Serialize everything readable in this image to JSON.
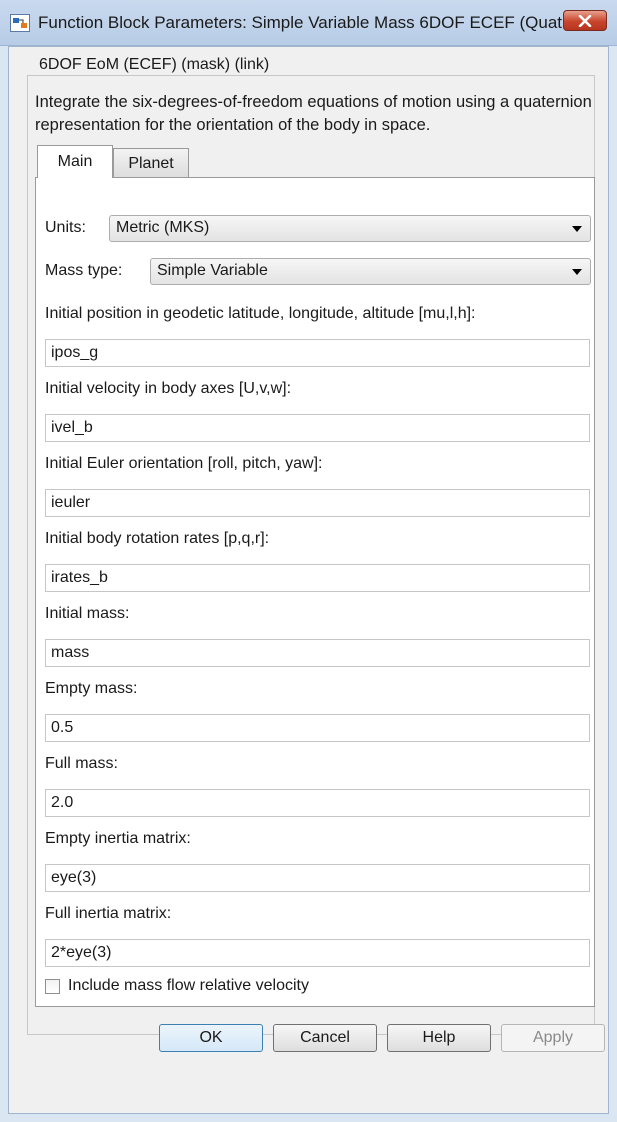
{
  "window": {
    "title": "Function Block Parameters: Simple Variable Mass 6DOF ECEF (Quat...",
    "close_icon": "close-icon"
  },
  "block": {
    "group_title": "6DOF EoM (ECEF) (mask) (link)",
    "description": "Integrate the six-degrees-of-freedom equations of motion using a quaternion representation for the orientation of the body in space."
  },
  "tabs": [
    {
      "label": "Main",
      "selected": true
    },
    {
      "label": "Planet",
      "selected": false
    }
  ],
  "units": {
    "label": "Units:",
    "value": "Metric (MKS)"
  },
  "mass_type": {
    "label": "Mass type:",
    "value": "Simple Variable"
  },
  "fields": [
    {
      "label": "Initial position in geodetic latitude, longitude, altitude [mu,l,h]:",
      "value": "ipos_g"
    },
    {
      "label": "Initial velocity in body axes [U,v,w]:",
      "value": "ivel_b"
    },
    {
      "label": "Initial Euler orientation [roll, pitch, yaw]:",
      "value": "ieuler"
    },
    {
      "label": "Initial body rotation rates [p,q,r]:",
      "value": "irates_b"
    },
    {
      "label": "Initial mass:",
      "value": "mass"
    },
    {
      "label": "Empty mass:",
      "value": "0.5"
    },
    {
      "label": "Full mass:",
      "value": "2.0"
    },
    {
      "label": "Empty inertia matrix:",
      "value": "eye(3)"
    },
    {
      "label": "Full inertia matrix:",
      "value": "2*eye(3)"
    }
  ],
  "checkbox": {
    "label": "Include mass flow relative velocity",
    "checked": false
  },
  "buttons": {
    "ok": "OK",
    "cancel": "Cancel",
    "help": "Help",
    "apply": "Apply"
  }
}
